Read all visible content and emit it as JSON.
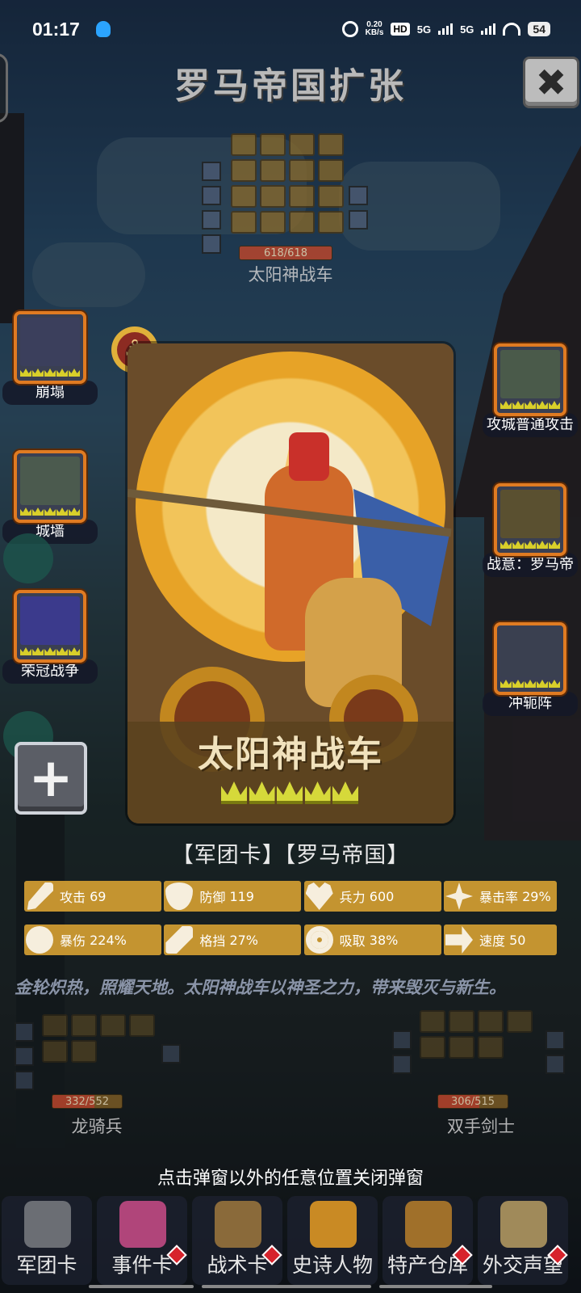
{
  "status_bar": {
    "time": "01:17",
    "net_speed_value": "0.20",
    "net_speed_unit": "KB/s",
    "hd_label": "HD",
    "signal1": "5G",
    "signal2": "5G",
    "battery": "54"
  },
  "header": {
    "title": "罗马帝国扩张",
    "close_icon": "close-x-icon",
    "close_glyph": "✖"
  },
  "enemy_top": {
    "hp_text": "618/618",
    "hp_fraction": 1.0,
    "name": "太阳神战车"
  },
  "left_skills": [
    {
      "label": "崩塌",
      "art_color": "#3b3f5c"
    },
    {
      "label": "城墙",
      "art_color": "#4b5a4e"
    },
    {
      "label": "荣冠战争",
      "art_color": "#3b3a8c"
    }
  ],
  "right_skills": [
    {
      "label": "攻城普通攻击",
      "art_color": "#4a5a4a"
    },
    {
      "label": "战意：罗马帝",
      "art_color": "#5a5030"
    },
    {
      "label": "冲轭阵",
      "art_color": "#3a4050"
    }
  ],
  "add_button": {
    "glyph": "+"
  },
  "card": {
    "name": "太阳神战车",
    "crown_count": 5,
    "emblem_glyph": "⚓"
  },
  "tags": "【军团卡】【罗马帝国】",
  "stats": [
    {
      "icon": "sword-icon",
      "label": "攻击",
      "value": "69"
    },
    {
      "icon": "shield-icon",
      "label": "防御",
      "value": "119"
    },
    {
      "icon": "heart-icon",
      "label": "兵力",
      "value": "600"
    },
    {
      "icon": "crit-icon",
      "label": "暴击率",
      "value": "29%"
    },
    {
      "icon": "burst-icon",
      "label": "暴伤",
      "value": "224%"
    },
    {
      "icon": "block-icon",
      "label": "格挡",
      "value": "27%"
    },
    {
      "icon": "absorb-icon",
      "label": "吸取",
      "value": "38%"
    },
    {
      "icon": "speed-icon",
      "label": "速度",
      "value": "50"
    }
  ],
  "description": "金轮炽热，照耀天地。太阳神战车以神圣之力，带来毁灭与新生。",
  "lower_units": [
    {
      "name": "龙骑兵",
      "hp_text": "332/552",
      "hp_fraction": 0.6
    },
    {
      "name": "双手剑士",
      "hp_text": "306/515",
      "hp_fraction": 0.59
    }
  ],
  "close_hint": "点击弹窗以外的任意位置关闭弹窗",
  "bottom_nav": [
    {
      "label": "军团卡",
      "icon": "helmet-icon",
      "color": "#6b6e74",
      "badge": false
    },
    {
      "label": "事件卡",
      "icon": "scroll-icon",
      "color": "#b0457a",
      "badge": true
    },
    {
      "label": "战术卡",
      "icon": "crest-icon",
      "color": "#8a6a3a",
      "badge": true
    },
    {
      "label": "史诗人物",
      "icon": "crown-icon",
      "color": "#c98a24",
      "badge": false
    },
    {
      "label": "特产仓库",
      "icon": "chest-icon",
      "color": "#a0702a",
      "badge": true
    },
    {
      "label": "外交声望",
      "icon": "letter-icon",
      "color": "#a08a5a",
      "badge": true
    }
  ]
}
